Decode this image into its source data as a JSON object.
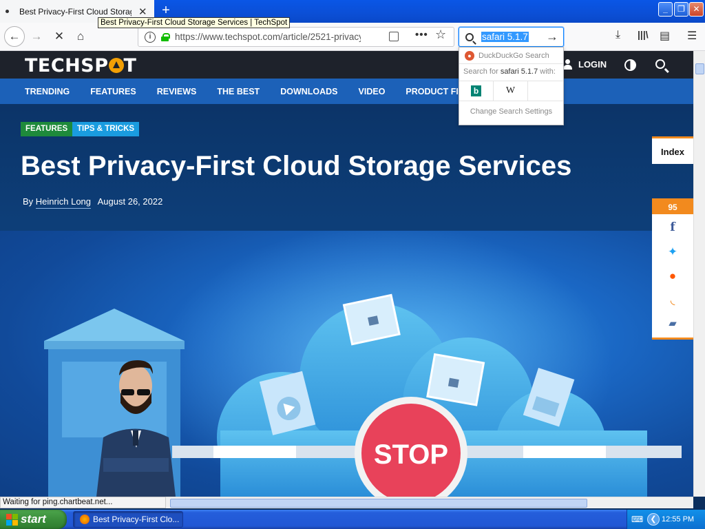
{
  "browser": {
    "tab_title": "Best Privacy-First Cloud Storage S",
    "tooltip": "Best Privacy-First Cloud Storage Services | TechSpot",
    "url": "https://www.techspot.com/article/2521-privacy",
    "search_value": "safari 5.1.7",
    "search_popup": {
      "engine_header": "DuckDuckGo Search",
      "search_for_prefix": "Search for",
      "search_for_query": "safari 5.1.7",
      "search_for_suffix": "with:",
      "engines": [
        "b",
        "W"
      ],
      "settings_label": "Change Search Settings"
    },
    "status_text": "Waiting for ping.chartbeat.net..."
  },
  "site": {
    "logo": "TECHSP",
    "logo_end": "T",
    "login_label": "LOGIN",
    "nav": [
      "TRENDING",
      "FEATURES",
      "REVIEWS",
      "THE BEST",
      "DOWNLOADS",
      "VIDEO",
      "PRODUCT FINDE"
    ]
  },
  "article": {
    "tags": [
      "FEATURES",
      "TIPS & TRICKS"
    ],
    "title": "Best Privacy-First Cloud Storage Services",
    "by_prefix": "By",
    "author": "Heinrich Long",
    "date": "August 26, 2022",
    "illustration_text": "STOP"
  },
  "rail": {
    "index_label": "Index",
    "share_count": "95",
    "share_icons": [
      "facebook-icon",
      "twitter-icon",
      "reddit-icon",
      "rss-icon",
      "comments-icon"
    ]
  },
  "taskbar": {
    "start_label": "start",
    "window_label": "Best Privacy-First Clo...",
    "clock": "12:55 PM"
  },
  "colors": {
    "site_nav_blue": "#1c61b8",
    "header_dark": "#1e222b",
    "accent_orange": "#f28a1e",
    "tag_features": "#1e8a3b",
    "tag_tips": "#1a9ce0"
  }
}
